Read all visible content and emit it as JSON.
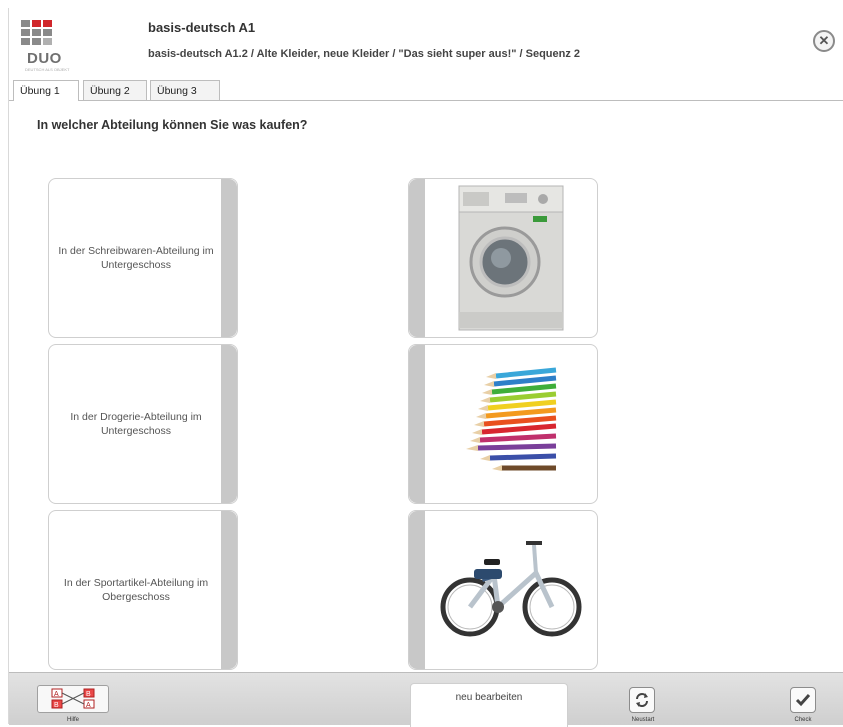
{
  "header": {
    "logo_text": "DUO",
    "logo_subtext": "DEUTSCH ALS OBJEKT",
    "title": "basis-deutsch A1",
    "breadcrumb": "basis-deutsch A1.2 / Alte Kleider, neue Kleider / \"Das sieht super aus!\" / Sequenz 2",
    "close_icon": "close-icon"
  },
  "tabs": [
    {
      "label": "Übung 1",
      "active": true
    },
    {
      "label": "Übung 2",
      "active": false
    },
    {
      "label": "Übung 3",
      "active": false
    }
  ],
  "question": "In welcher Abteilung können Sie was kaufen?",
  "left_cards": [
    {
      "text": "In der Schreibwaren-Abteilung im Untergeschoss"
    },
    {
      "text": "In der Drogerie-Abteilung im Untergeschoss"
    },
    {
      "text": "In der Sportartikel-Abteilung im Obergeschoss"
    }
  ],
  "right_cards": [
    {
      "image": "washing-machine"
    },
    {
      "image": "colored-pencils"
    },
    {
      "image": "bicycle"
    }
  ],
  "footer": {
    "hilfe_label": "Hilfe",
    "neu_label": "neu bearbeiten",
    "neustart_label": "Neustart",
    "check_label": "Check"
  },
  "colors": {
    "logo_red": "#d0262b",
    "logo_gray": "#8a8a8a",
    "card_side": "#c8c8c8",
    "footer_bg": "#d8d8d8"
  }
}
